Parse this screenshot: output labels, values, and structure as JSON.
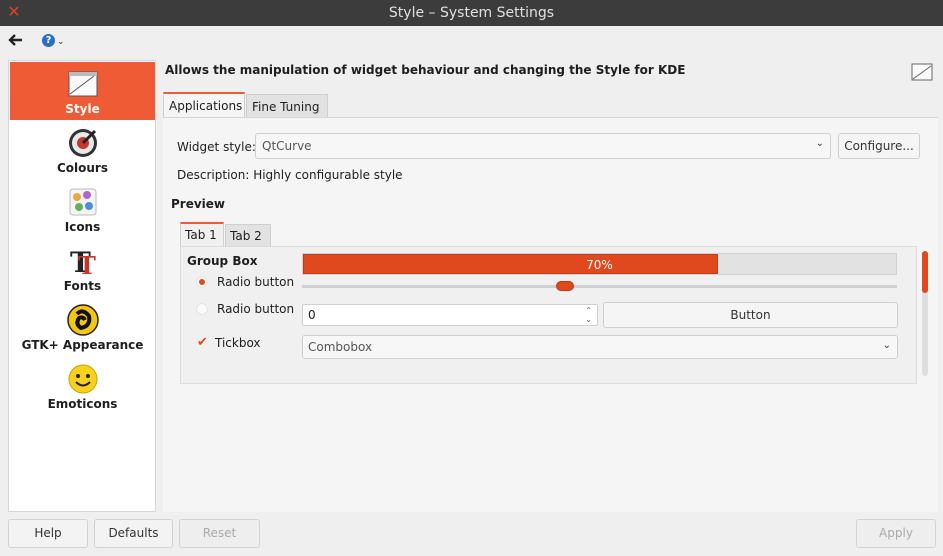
{
  "window": {
    "title": "Style – System Settings"
  },
  "toolbar": {
    "back_icon": "back-arrow-icon",
    "help_icon": "help-icon"
  },
  "sidebar": {
    "items": [
      {
        "label": "Style",
        "icon": "style-icon",
        "active": true
      },
      {
        "label": "Colours",
        "icon": "colours-icon"
      },
      {
        "label": "Icons",
        "icon": "icons-icon"
      },
      {
        "label": "Fonts",
        "icon": "fonts-icon"
      },
      {
        "label": "GTK+ Appearance",
        "icon": "gtk-icon"
      },
      {
        "label": "Emoticons",
        "icon": "emoticons-icon"
      }
    ]
  },
  "main": {
    "headline": "Allows the manipulation of widget behaviour and changing the Style for KDE",
    "tabs": [
      {
        "label": "Applications",
        "active": true
      },
      {
        "label": "Fine Tuning"
      }
    ],
    "widget_style_label": "Widget style:",
    "widget_style_value": "QtCurve",
    "configure_label": "Configure...",
    "description": "Description: Highly configurable style",
    "preview_title": "Preview",
    "preview_tabs": [
      {
        "label": "Tab 1",
        "active": true
      },
      {
        "label": "Tab 2"
      }
    ],
    "preview": {
      "group_box": "Group Box",
      "progress_text": "70%",
      "progress_value": 0.7,
      "slider_value": 0.44,
      "radio1": "Radio button",
      "radio2": "Radio button",
      "spin_value": "0",
      "button_label": "Button",
      "tickbox_label": "Tickbox",
      "tickbox_mark": "✔",
      "combobox_value": "Combobox"
    }
  },
  "bottom": {
    "help": "Help",
    "defaults": "Defaults",
    "reset": "Reset",
    "apply": "Apply"
  },
  "colors": {
    "accent": "#ef5b34",
    "progress": "#e0481e",
    "titlebar": "#3c3c3c"
  }
}
